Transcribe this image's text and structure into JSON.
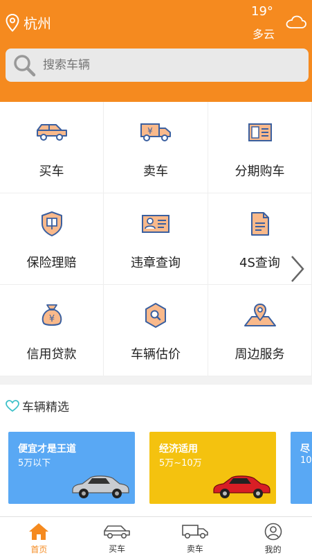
{
  "header": {
    "city": "杭州",
    "temperature": "19°",
    "condition": "多云"
  },
  "search": {
    "placeholder": "搜索车辆"
  },
  "menu": [
    {
      "label": "买车",
      "icon": "car-icon"
    },
    {
      "label": "卖车",
      "icon": "truck-yen-icon"
    },
    {
      "label": "分期购车",
      "icon": "document-icon"
    },
    {
      "label": "保险理赔",
      "icon": "shield-icon"
    },
    {
      "label": "违章查询",
      "icon": "id-card-icon"
    },
    {
      "label": "4S查询",
      "icon": "file-icon"
    },
    {
      "label": "信用贷款",
      "icon": "money-bag-icon"
    },
    {
      "label": "车辆估价",
      "icon": "hexagon-search-icon"
    },
    {
      "label": "周边服务",
      "icon": "map-pin-icon"
    }
  ],
  "featured": {
    "title": "车辆精选",
    "cards": [
      {
        "title": "便宜才是王道",
        "subtitle": "5万以下"
      },
      {
        "title": "经济适用",
        "subtitle": "5万~10万"
      },
      {
        "title": "尽",
        "subtitle": "10"
      }
    ]
  },
  "tabs": [
    {
      "label": "首页"
    },
    {
      "label": "买车"
    },
    {
      "label": "卖车"
    },
    {
      "label": "我的"
    }
  ],
  "colors": {
    "brand": "#f58a1f",
    "card_blue": "#59a8f4",
    "card_yellow": "#f4c20f"
  }
}
